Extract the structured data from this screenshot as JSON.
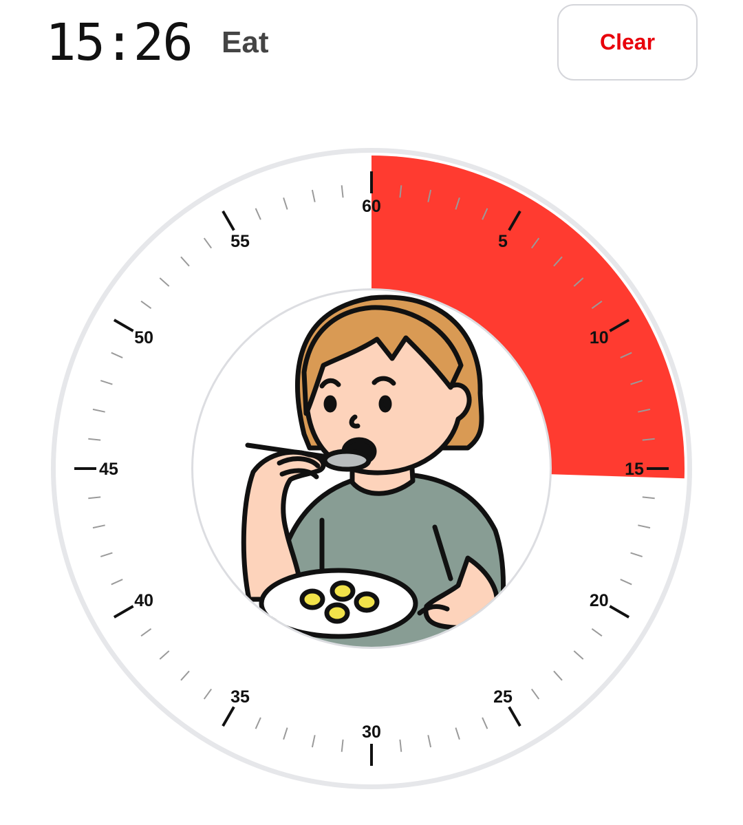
{
  "header": {
    "time": "15:26",
    "activity": "Eat",
    "clear_label": "Clear"
  },
  "timer": {
    "total_minutes": 60,
    "remaining_minutes": 15.3,
    "elapsed_color": "#ff3b30",
    "tick_labels": [
      "60",
      "5",
      "10",
      "15",
      "20",
      "25",
      "30",
      "35",
      "40",
      "45",
      "50",
      "55"
    ]
  },
  "illustration": {
    "icon": "child-eating-icon"
  }
}
